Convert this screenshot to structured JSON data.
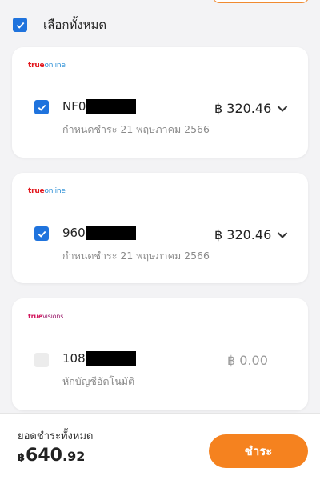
{
  "select_all": {
    "label": "เลือกทั้งหมด",
    "checked": true
  },
  "bills": [
    {
      "brand": {
        "part1": "true",
        "part2": "online"
      },
      "account_prefix": "NF0",
      "due": "กำหนดชำระ 21 พฤษภาคม 2566",
      "amount": "฿ 320.46",
      "checked": true
    },
    {
      "brand": {
        "part1": "true",
        "part2": "online"
      },
      "account_prefix": "960",
      "due": "กำหนดชำระ 21 พฤษภาคม 2566",
      "amount": "฿ 320.46",
      "checked": true
    },
    {
      "brand": {
        "part1": "true",
        "part2": "visions"
      },
      "account_prefix": "108",
      "due": "หักบัญชีอัตโนมัติ",
      "amount": "฿ 0.00",
      "checked": false
    }
  ],
  "footer": {
    "total_label": "ยอดชำระทั้งหมด",
    "currency": "฿",
    "total_integer": "640",
    "total_decimal": ".92",
    "pay_label": "ชำระ"
  },
  "colors": {
    "accent": "#f5821f",
    "check": "#1f73dd"
  }
}
